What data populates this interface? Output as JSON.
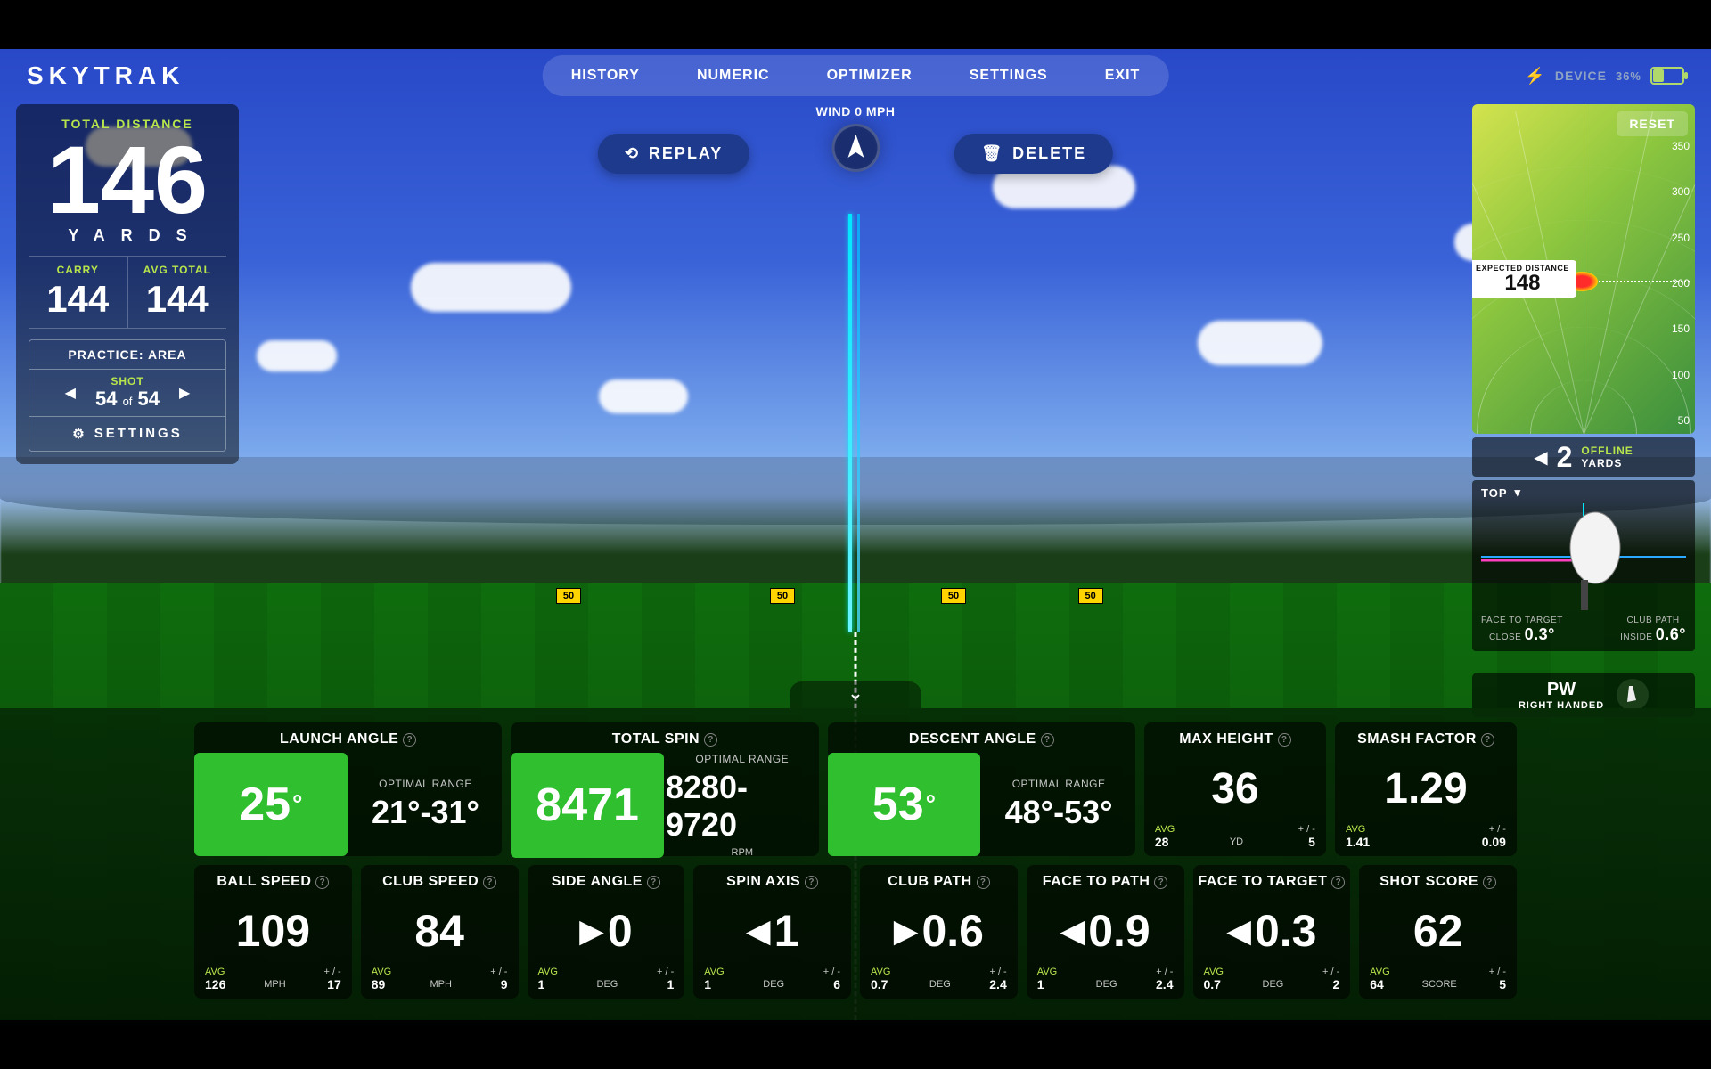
{
  "brand": "SKYTRAK",
  "nav": {
    "history": "HISTORY",
    "numeric": "NUMERIC",
    "optimizer": "OPTIMIZER",
    "settings": "SETTINGS",
    "exit": "EXIT"
  },
  "device": {
    "label": "DEVICE",
    "pct": "36%"
  },
  "wind": {
    "text": "WIND 0 MPH"
  },
  "actions": {
    "replay": "REPLAY",
    "delete": "DELETE"
  },
  "field_markers": {
    "m50": "50"
  },
  "total_distance": {
    "label": "TOTAL DISTANCE",
    "value": "146",
    "unit": "YARDS"
  },
  "carry": {
    "label": "CARRY",
    "value": "144"
  },
  "avg_total": {
    "label": "AVG TOTAL",
    "value": "144"
  },
  "practice": {
    "title": "PRACTICE: AREA",
    "shot_label": "SHOT",
    "current": "54",
    "of": "of",
    "total": "54",
    "settings": "SETTINGS"
  },
  "mini_map": {
    "reset": "RESET",
    "ticks": [
      "350",
      "300",
      "250",
      "200",
      "150",
      "100",
      "50"
    ],
    "expected": {
      "label": "EXPECTED DISTANCE",
      "value": "148"
    }
  },
  "offline": {
    "value": "2",
    "label": "OFFLINE",
    "unit": "YARDS"
  },
  "club_widget": {
    "view": "TOP",
    "face_to_target": {
      "label": "FACE TO TARGET",
      "sub": "CLOSE",
      "value": "0.3°"
    },
    "club_path": {
      "label": "CLUB PATH",
      "sub": "INSIDE",
      "value": "0.6°"
    }
  },
  "club_sel": {
    "name": "PW",
    "hand": "RIGHT HANDED"
  },
  "metrics": {
    "launch_angle": {
      "title": "LAUNCH ANGLE",
      "value": "25",
      "opt_label": "OPTIMAL RANGE",
      "opt_value": "21°-31°"
    },
    "total_spin": {
      "title": "TOTAL SPIN",
      "value": "8471",
      "opt_label": "OPTIMAL RANGE",
      "opt_value": "8280-9720",
      "opt_sub": "RPM"
    },
    "descent": {
      "title": "DESCENT ANGLE",
      "value": "53",
      "opt_label": "OPTIMAL RANGE",
      "opt_value": "48°-53°"
    },
    "max_height": {
      "title": "MAX HEIGHT",
      "value": "36",
      "unit": "YD",
      "avg": "28",
      "pm": "5"
    },
    "smash": {
      "title": "SMASH FACTOR",
      "value": "1.29",
      "avg": "1.41",
      "pm": "0.09"
    },
    "ball_speed": {
      "title": "BALL SPEED",
      "value": "109",
      "unit": "MPH",
      "avg": "126",
      "pm": "17"
    },
    "club_speed": {
      "title": "CLUB SPEED",
      "value": "84",
      "unit": "MPH",
      "avg": "89",
      "pm": "9"
    },
    "side_angle": {
      "title": "SIDE ANGLE",
      "value": "0",
      "unit": "DEG",
      "avg": "1",
      "pm": "1",
      "dir": "▶"
    },
    "spin_axis": {
      "title": "SPIN AXIS",
      "value": "1",
      "unit": "DEG",
      "avg": "1",
      "pm": "6",
      "dir": "◀"
    },
    "club_path": {
      "title": "CLUB PATH",
      "value": "0.6",
      "unit": "DEG",
      "avg": "0.7",
      "pm": "2.4",
      "dir": "▶"
    },
    "face_to_path": {
      "title": "FACE TO PATH",
      "value": "0.9",
      "unit": "DEG",
      "avg": "1",
      "pm": "2.4",
      "dir": "◀"
    },
    "face_to_target": {
      "title": "FACE TO TARGET",
      "value": "0.3",
      "unit": "DEG",
      "avg": "0.7",
      "pm": "2",
      "dir": "◀"
    },
    "shot_score": {
      "title": "SHOT SCORE",
      "value": "62",
      "unit": "SCORE",
      "avg": "64",
      "pm": "5"
    }
  },
  "labels": {
    "avg": "AVG",
    "pm": "+ / -"
  }
}
